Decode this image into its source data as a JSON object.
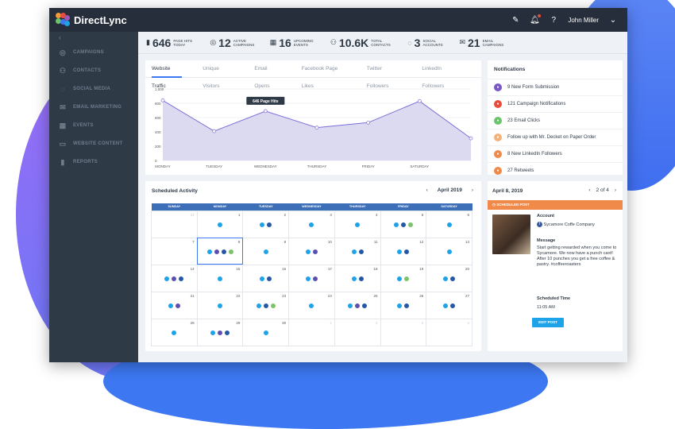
{
  "brand": {
    "name": "DirectLync"
  },
  "topbar": {
    "user": "John Miller"
  },
  "sidebar": {
    "items": [
      {
        "label": "CAMPAIGNS",
        "icon": "target-icon"
      },
      {
        "label": "CONTACTS",
        "icon": "person-icon"
      },
      {
        "label": "SOCIAL MEDIA",
        "icon": "speech-bubble-icon"
      },
      {
        "label": "EMAIL MARKETING",
        "icon": "envelope-icon"
      },
      {
        "label": "EVENTS",
        "icon": "calendar-icon"
      },
      {
        "label": "WEBSITE CONTENT",
        "icon": "monitor-icon"
      },
      {
        "label": "REPORTS",
        "icon": "bar-chart-icon"
      }
    ]
  },
  "stats": [
    {
      "value": "646",
      "line1": "PAGE HITS",
      "line2": "TODAY",
      "icon": "bar-chart-icon"
    },
    {
      "value": "12",
      "line1": "ACTIVE",
      "line2": "CAMPAIGNS",
      "icon": "target-icon"
    },
    {
      "value": "16",
      "line1": "UPCOMING",
      "line2": "EVENTS",
      "icon": "calendar-icon"
    },
    {
      "value": "10.6K",
      "line1": "TOTAL",
      "line2": "CONTACTS",
      "icon": "person-icon"
    },
    {
      "value": "3",
      "line1": "SOCIAL",
      "line2": "ACCOUNTS",
      "icon": "speech-bubble-icon"
    },
    {
      "value": "21",
      "line1": "EMAIL",
      "line2": "CAMPAIGNS",
      "icon": "envelope-icon"
    }
  ],
  "traffic": {
    "tabs": [
      "Website Traffic",
      "Unique Visitors",
      "Email Opens",
      "Facebook Page Likes",
      "Twitter Followers",
      "LinkedIn Followers"
    ],
    "tooltip": "646 Page Hits"
  },
  "chart_data": {
    "type": "area",
    "x": [
      "MONDAY",
      "TUESDAY",
      "WEDNESDAY",
      "THURSDAY",
      "FRIDAY",
      "SATURDAY",
      ""
    ],
    "y": [
      840,
      410,
      690,
      460,
      530,
      830,
      310
    ],
    "yticks": [
      0,
      200,
      400,
      600,
      800,
      1000
    ],
    "ylim": [
      0,
      1000
    ],
    "ytick_labels": [
      "0",
      "200",
      "400",
      "600",
      "800",
      "1,000"
    ],
    "highlight_index": 2,
    "colors": {
      "line": "#7b6fd6",
      "fill": "#dcdaf0"
    }
  },
  "notifications": {
    "title": "Notifications",
    "items": [
      {
        "text": "9 New Form Submission",
        "color": "#7a56c7"
      },
      {
        "text": "121 Campaign Notifications",
        "color": "#e74c3c"
      },
      {
        "text": "23 Email Clicks",
        "color": "#6ac46a"
      },
      {
        "text": "Follow up with Mr. Decket on Paper Order",
        "color": "#f3b27a"
      },
      {
        "text": "8 New LinkedIn Followers",
        "color": "#f08a4b"
      },
      {
        "text": "27 Retweets",
        "color": "#f08a4b"
      }
    ]
  },
  "calendar": {
    "title": "Scheduled Activity",
    "month": "April 2019",
    "days": [
      "SUNDAY",
      "MONDAY",
      "TUESDAY",
      "WEDNESDAY",
      "THURSDAY",
      "FRIDAY",
      "SATURDAY"
    ],
    "weeks": [
      [
        {
          "n": "31",
          "dim": true,
          "dots": []
        },
        {
          "n": "1",
          "dots": [
            "#1ea3e8"
          ]
        },
        {
          "n": "2",
          "dots": [
            "#1ea3e8",
            "#2458a6"
          ]
        },
        {
          "n": "3",
          "dots": [
            "#1ea3e8"
          ]
        },
        {
          "n": "4",
          "dots": [
            "#1ea3e8"
          ]
        },
        {
          "n": "5",
          "dots": [
            "#1ea3e8",
            "#2458a6",
            "#7cc36a"
          ]
        },
        {
          "n": "6",
          "dots": [
            "#1ea3e8"
          ]
        }
      ],
      [
        {
          "n": "7",
          "dots": []
        },
        {
          "n": "8",
          "dots": [
            "#1ea3e8",
            "#5a4fb0",
            "#2458a6",
            "#7cc36a"
          ],
          "sel": true
        },
        {
          "n": "9",
          "dots": [
            "#1ea3e8"
          ]
        },
        {
          "n": "10",
          "dots": [
            "#1ea3e8",
            "#5a4fb0"
          ]
        },
        {
          "n": "11",
          "dots": [
            "#1ea3e8",
            "#2458a6"
          ]
        },
        {
          "n": "12",
          "dots": [
            "#1ea3e8",
            "#2458a6"
          ]
        },
        {
          "n": "13",
          "dots": [
            "#1ea3e8"
          ]
        }
      ],
      [
        {
          "n": "14",
          "dots": [
            "#1ea3e8",
            "#5a4fb0",
            "#2458a6"
          ]
        },
        {
          "n": "15",
          "dots": [
            "#1ea3e8"
          ]
        },
        {
          "n": "16",
          "dots": [
            "#1ea3e8",
            "#2458a6"
          ]
        },
        {
          "n": "17",
          "dots": [
            "#1ea3e8",
            "#5a4fb0"
          ]
        },
        {
          "n": "18",
          "dots": [
            "#1ea3e8",
            "#2458a6"
          ]
        },
        {
          "n": "19",
          "dots": [
            "#1ea3e8",
            "#7cc36a"
          ]
        },
        {
          "n": "20",
          "dots": [
            "#1ea3e8",
            "#2458a6"
          ]
        }
      ],
      [
        {
          "n": "21",
          "dots": [
            "#1ea3e8",
            "#5a4fb0"
          ]
        },
        {
          "n": "22",
          "dots": [
            "#1ea3e8"
          ]
        },
        {
          "n": "23",
          "dots": [
            "#1ea3e8",
            "#2458a6",
            "#7cc36a"
          ]
        },
        {
          "n": "24",
          "dots": [
            "#1ea3e8"
          ]
        },
        {
          "n": "25",
          "dots": [
            "#1ea3e8",
            "#5a4fb0",
            "#2458a6"
          ]
        },
        {
          "n": "26",
          "dots": [
            "#1ea3e8",
            "#2458a6"
          ]
        },
        {
          "n": "27",
          "dots": [
            "#1ea3e8",
            "#2458a6"
          ]
        }
      ],
      [
        {
          "n": "28",
          "dots": [
            "#1ea3e8"
          ]
        },
        {
          "n": "29",
          "dots": [
            "#1ea3e8",
            "#5a4fb0",
            "#2458a6"
          ]
        },
        {
          "n": "30",
          "dots": [
            "#1ea3e8"
          ]
        },
        {
          "n": "1",
          "dim": true,
          "dots": []
        },
        {
          "n": "2",
          "dim": true,
          "dots": []
        },
        {
          "n": "3",
          "dim": true,
          "dots": []
        },
        {
          "n": "4",
          "dim": true,
          "dots": []
        }
      ]
    ]
  },
  "post": {
    "date": "April 8, 2019",
    "pager": "2 of 4",
    "banner": "SCHEDULED POST",
    "account_label": "Account",
    "account": "Sycamore Coffe Company",
    "message_label": "Message",
    "message": "Start getting rewarded when you come to Sycamore. We now have a punch card! After 10 punches you get a free coffee & pastry. #coffeeroasters",
    "time_label": "Scheduled Time",
    "time": "11:05 AM",
    "button": "EDIT POST"
  }
}
